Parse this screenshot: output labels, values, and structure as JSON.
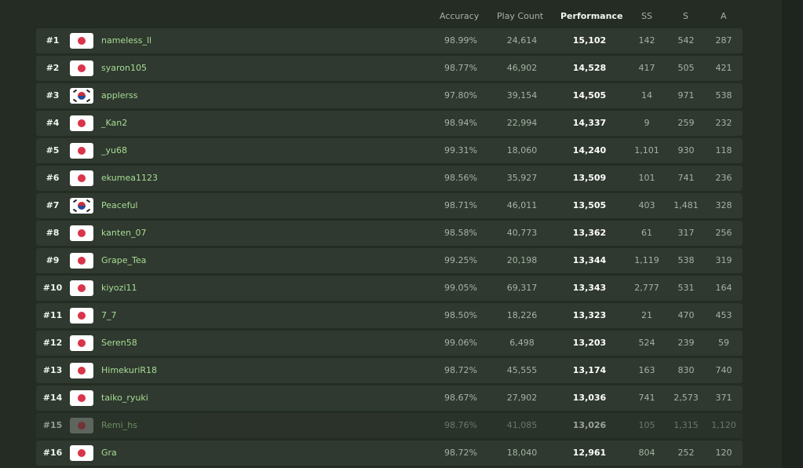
{
  "columns": {
    "accuracy": "Accuracy",
    "play_count": "Play Count",
    "performance": "Performance",
    "ss": "SS",
    "s": "S",
    "a": "A"
  },
  "rows": [
    {
      "rank": "#1",
      "flag": "jp-flag-icon",
      "name": "nameless_ll",
      "accuracy": "98.99%",
      "play_count": "24,614",
      "performance": "15,102",
      "ss": "142",
      "s": "542",
      "a": "287"
    },
    {
      "rank": "#2",
      "flag": "jp-flag-icon",
      "name": "syaron105",
      "accuracy": "98.77%",
      "play_count": "46,902",
      "performance": "14,528",
      "ss": "417",
      "s": "505",
      "a": "421"
    },
    {
      "rank": "#3",
      "flag": "kr-flag-icon",
      "name": "applerss",
      "accuracy": "97.80%",
      "play_count": "39,154",
      "performance": "14,505",
      "ss": "14",
      "s": "971",
      "a": "538"
    },
    {
      "rank": "#4",
      "flag": "jp-flag-icon",
      "name": "_Kan2",
      "accuracy": "98.94%",
      "play_count": "22,994",
      "performance": "14,337",
      "ss": "9",
      "s": "259",
      "a": "232"
    },
    {
      "rank": "#5",
      "flag": "jp-flag-icon",
      "name": "_yu68",
      "accuracy": "99.31%",
      "play_count": "18,060",
      "performance": "14,240",
      "ss": "1,101",
      "s": "930",
      "a": "118"
    },
    {
      "rank": "#6",
      "flag": "jp-flag-icon",
      "name": "ekumea1123",
      "accuracy": "98.56%",
      "play_count": "35,927",
      "performance": "13,509",
      "ss": "101",
      "s": "741",
      "a": "236"
    },
    {
      "rank": "#7",
      "flag": "kr-flag-icon",
      "name": "Peaceful",
      "accuracy": "98.71%",
      "play_count": "46,011",
      "performance": "13,505",
      "ss": "403",
      "s": "1,481",
      "a": "328"
    },
    {
      "rank": "#8",
      "flag": "jp-flag-icon",
      "name": "kanten_07",
      "accuracy": "98.58%",
      "play_count": "40,773",
      "performance": "13,362",
      "ss": "61",
      "s": "317",
      "a": "256"
    },
    {
      "rank": "#9",
      "flag": "jp-flag-icon",
      "name": "Grape_Tea",
      "accuracy": "99.25%",
      "play_count": "20,198",
      "performance": "13,344",
      "ss": "1,119",
      "s": "538",
      "a": "319"
    },
    {
      "rank": "#10",
      "flag": "jp-flag-icon",
      "name": "kiyozi11",
      "accuracy": "99.05%",
      "play_count": "69,317",
      "performance": "13,343",
      "ss": "2,777",
      "s": "531",
      "a": "164"
    },
    {
      "rank": "#11",
      "flag": "jp-flag-icon",
      "name": "7_7",
      "accuracy": "98.50%",
      "play_count": "18,226",
      "performance": "13,323",
      "ss": "21",
      "s": "470",
      "a": "453"
    },
    {
      "rank": "#12",
      "flag": "jp-flag-icon",
      "name": "Seren58",
      "accuracy": "99.06%",
      "play_count": "6,498",
      "performance": "13,203",
      "ss": "524",
      "s": "239",
      "a": "59"
    },
    {
      "rank": "#13",
      "flag": "jp-flag-icon",
      "name": "HimekuriR18",
      "accuracy": "98.72%",
      "play_count": "45,555",
      "performance": "13,174",
      "ss": "163",
      "s": "830",
      "a": "740"
    },
    {
      "rank": "#14",
      "flag": "jp-flag-icon",
      "name": "taiko_ryuki",
      "accuracy": "98.67%",
      "play_count": "27,902",
      "performance": "13,036",
      "ss": "741",
      "s": "2,573",
      "a": "371"
    },
    {
      "rank": "#15",
      "flag": "jp-flag-icon",
      "name": "Remi_hs",
      "accuracy": "98.76%",
      "play_count": "41,085",
      "performance": "13,026",
      "ss": "105",
      "s": "1,315",
      "a": "1,120",
      "inactive": true
    },
    {
      "rank": "#16",
      "flag": "jp-flag-icon",
      "name": "Gra",
      "accuracy": "98.72%",
      "play_count": "18,040",
      "performance": "12,961",
      "ss": "804",
      "s": "252",
      "a": "120"
    }
  ]
}
